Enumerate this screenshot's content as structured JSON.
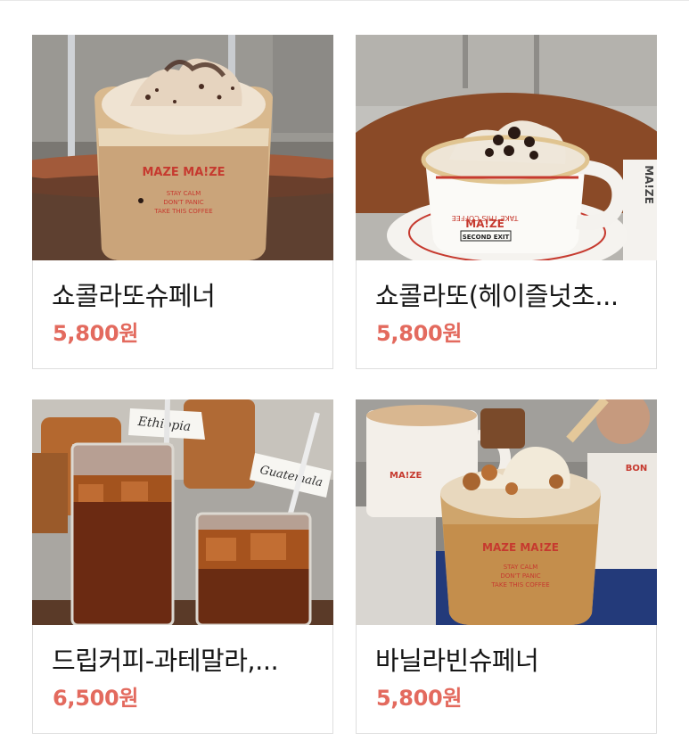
{
  "products": [
    {
      "name": "쇼콜라또슈페너",
      "price": "5,800원",
      "cup_text": [
        "MAZE MA!ZE",
        "STAY CALM",
        "DON'T PANIC",
        "TAKE THIS COFFEE"
      ]
    },
    {
      "name": "쇼콜라또(헤이즐넛초...",
      "price": "5,800원",
      "cup_text": [
        "TAKE THIS COFFEE",
        "MA!ZE",
        "SECOND EXIT"
      ],
      "paper_text": "MA!ZE"
    },
    {
      "name": "드립커피-과테말라,...",
      "price": "6,500원",
      "tags": [
        "Ethiopia",
        "Guatemala"
      ]
    },
    {
      "name": "바닐라빈슈페너",
      "price": "5,800원",
      "cup_text": [
        "MAZE MA!ZE",
        "STAY CALM",
        "DON'T PANIC",
        "TAKE THIS COFFEE"
      ],
      "mug_text": "MA!ZE"
    }
  ],
  "colors": {
    "price": "#e36a5e",
    "brand_red": "#c63a2f",
    "border": "#dedede"
  }
}
